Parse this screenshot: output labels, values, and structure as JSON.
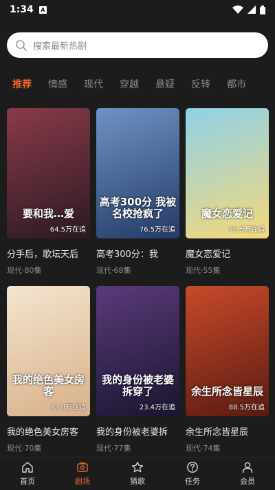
{
  "status_bar": {
    "time": "1:34",
    "app_badge": "A"
  },
  "search": {
    "placeholder": "搜索最新热剧"
  },
  "tabs": [
    {
      "label": "推荐",
      "active": true
    },
    {
      "label": "情感",
      "active": false
    },
    {
      "label": "现代",
      "active": false
    },
    {
      "label": "穿越",
      "active": false
    },
    {
      "label": "悬疑",
      "active": false
    },
    {
      "label": "反转",
      "active": false
    },
    {
      "label": "都市",
      "active": false
    }
  ],
  "dramas": [
    {
      "title": "分手后，歌坛天后",
      "genre": "现代",
      "episodes": "80集",
      "poster_text": "要和我…爱",
      "count": "64.5万在追",
      "colors": [
        "#8a3a4a",
        "#2a1a22"
      ]
    },
    {
      "title": "高考300分：我",
      "genre": "现代",
      "episodes": "68集",
      "poster_text": "高考300分 我被名校抢疯了",
      "count": "76.5万在追",
      "colors": [
        "#6f93c4",
        "#253a66"
      ]
    },
    {
      "title": "魔女恋爱记",
      "genre": "现代",
      "episodes": "55集",
      "poster_text": "魔女恋爱记",
      "count": "42.5万在追",
      "colors": [
        "#8fd1e8",
        "#f4d87a"
      ]
    },
    {
      "title": "我的绝色美女房客",
      "genre": "现代",
      "episodes": "70集",
      "poster_text": "我的绝色美女房客",
      "count": "72.8万在追",
      "colors": [
        "#f3e5cf",
        "#d8b08a"
      ]
    },
    {
      "title": "我的身份被老婆拆",
      "genre": "现代",
      "episodes": "77集",
      "poster_text": "我的身份被老婆拆穿了",
      "count": "23.4万在追",
      "colors": [
        "#5a3a7a",
        "#1a1530"
      ]
    },
    {
      "title": "余生所念皆星辰",
      "genre": "现代",
      "episodes": "74集",
      "poster_text": "余生所念皆星辰",
      "count": "88.5万在追",
      "colors": [
        "#c84a2a",
        "#5a1a12"
      ]
    }
  ],
  "nav": [
    {
      "label": "首页",
      "icon": "home-icon",
      "active": false
    },
    {
      "label": "剧场",
      "icon": "theater-icon",
      "active": true
    },
    {
      "label": "猜歌",
      "icon": "star-icon",
      "active": false
    },
    {
      "label": "任务",
      "icon": "question-icon",
      "active": false
    },
    {
      "label": "会员",
      "icon": "user-icon",
      "active": false
    }
  ],
  "accent_color": "#f0672f"
}
